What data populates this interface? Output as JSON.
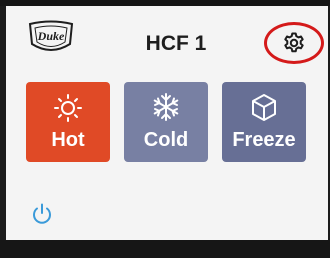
{
  "header": {
    "logo_text": "Duke",
    "title": "HCF 1",
    "settings_icon": "gear-icon",
    "highlight_color": "#d41a1a"
  },
  "modes": [
    {
      "label": "Hot",
      "icon": "sun-icon",
      "color": "#e04a26"
    },
    {
      "label": "Cold",
      "icon": "snowflake-icon",
      "color": "#7880a3"
    },
    {
      "label": "Freeze",
      "icon": "cube-icon",
      "color": "#676f95"
    }
  ],
  "footer": {
    "power_icon": "power-icon",
    "power_color": "#3a9ad9"
  }
}
